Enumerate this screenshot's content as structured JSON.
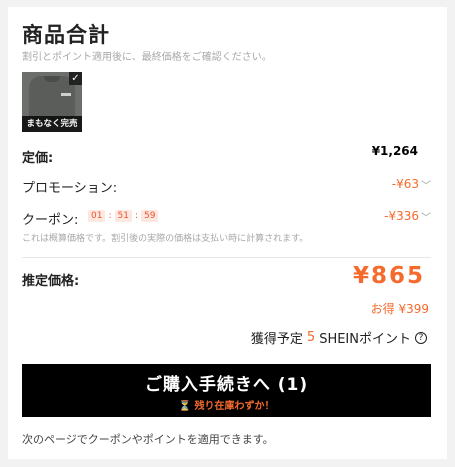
{
  "header": {
    "title": "商品合計",
    "subtitle": "割引とポイント適用後に、最終価格をご確認ください。"
  },
  "item": {
    "badge": "まもなく完売",
    "check": "✓"
  },
  "summary": {
    "price_label": "定価:",
    "price_value": "¥1,264",
    "promo_label": "プロモーション:",
    "promo_value": "-¥63",
    "coupon_label": "クーポン:",
    "timer": [
      "01",
      "51",
      "59"
    ],
    "coupon_value": "-¥336",
    "note": "これは概算価格です。割引後の実際の価格は支払い時に計算されます。",
    "estimated_label": "推定価格:",
    "estimated_value": "¥865",
    "savings": "お得 ¥399"
  },
  "points": {
    "prefix": "獲得予定",
    "count": "5",
    "suffix": "SHEINポイント",
    "help": "?"
  },
  "checkout": {
    "label": "ご購入手続きへ (1)",
    "warning": "⏳ 残り在庫わずか！"
  },
  "footer": {
    "text": "次のページでクーポンやポイントを適用できます。"
  },
  "colors": {
    "accent": "#f56a2d",
    "button": "#000000"
  }
}
